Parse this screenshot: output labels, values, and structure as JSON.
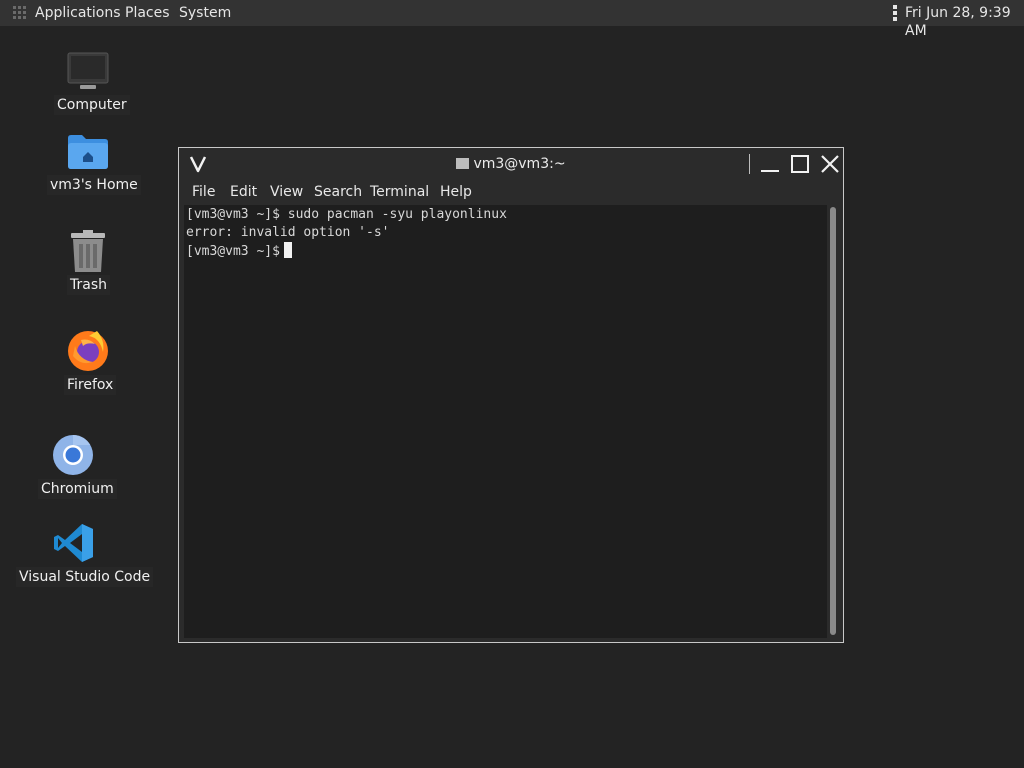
{
  "panel": {
    "applications": "Applications",
    "places": "Places",
    "system": "System",
    "clock": "Fri Jun 28,  9:39 AM"
  },
  "desktop": {
    "icons": [
      {
        "label": "Computer",
        "icon": "computer-icon"
      },
      {
        "label": "vm3's Home",
        "icon": "home-folder-icon"
      },
      {
        "label": "Trash",
        "icon": "trash-icon"
      },
      {
        "label": "Firefox",
        "icon": "firefox-icon"
      },
      {
        "label": "Chromium",
        "icon": "chromium-icon"
      },
      {
        "label": "Visual Studio Code",
        "icon": "vscode-icon"
      }
    ]
  },
  "terminal": {
    "title": "vm3@vm3:~",
    "menu": [
      "File",
      "Edit",
      "View",
      "Search",
      "Terminal",
      "Help"
    ],
    "lines": [
      "[vm3@vm3 ~]$ sudo pacman -syu playonlinux",
      "error: invalid option '-s'",
      "[vm3@vm3 ~]$"
    ]
  },
  "colors": {
    "desktop_bg": "#232323",
    "panel_bg": "#333333",
    "terminal_bg": "#1e1e1e"
  }
}
